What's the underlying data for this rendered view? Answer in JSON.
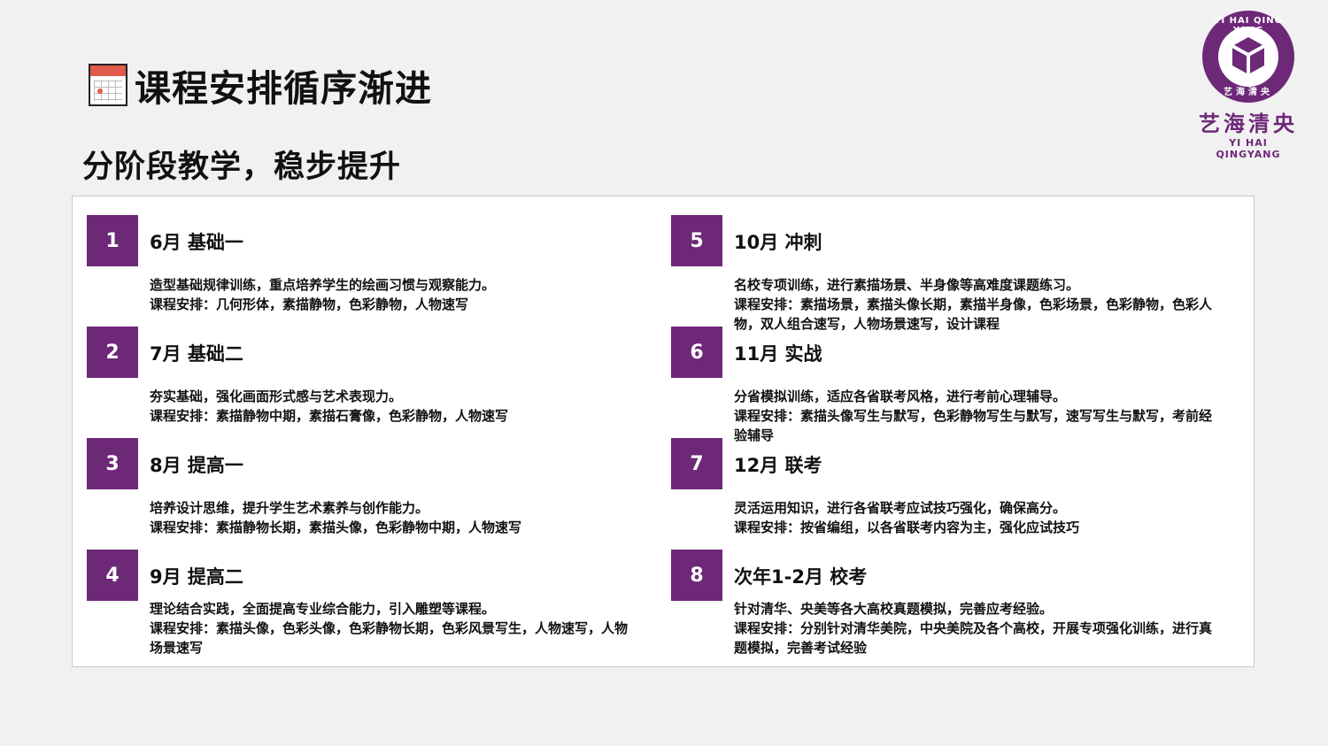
{
  "header": {
    "title": "课程安排循序渐进",
    "subtitle": "分阶段教学，稳步提升"
  },
  "logo": {
    "ring_top": "YI HAI QING YANG",
    "ring_bottom": "艺海清央",
    "name_cn": "艺海清央",
    "name_en": "YI HAI QINGYANG",
    "color": "#6d2878"
  },
  "accent_color": "#6d2878",
  "stages": [
    {
      "num": "1",
      "title": "6月 基础一",
      "desc": "造型基础规律训练，重点培养学生的绘画习惯与观察能力。",
      "plan": "课程安排：几何形体，素描静物，色彩静物，人物速写"
    },
    {
      "num": "2",
      "title": "7月 基础二",
      "desc": "夯实基础，强化画面形式感与艺术表现力。",
      "plan": "课程安排：素描静物中期，素描石膏像，色彩静物，人物速写"
    },
    {
      "num": "3",
      "title": "8月 提高一",
      "desc": "培养设计思维，提升学生艺术素养与创作能力。",
      "plan": "课程安排：素描静物长期，素描头像，色彩静物中期，人物速写"
    },
    {
      "num": "4",
      "title": "9月 提高二",
      "desc": "理论结合实践，全面提高专业综合能力，引入雕塑等课程。",
      "plan": "课程安排：素描头像，色彩头像，色彩静物长期，色彩风景写生，人物速写，人物场景速写"
    },
    {
      "num": "5",
      "title": "10月 冲刺",
      "desc": "名校专项训练，进行素描场景、半身像等高难度课题练习。",
      "plan": "课程安排：素描场景，素描头像长期，素描半身像，色彩场景，色彩静物，色彩人物，双人组合速写，人物场景速写，设计课程"
    },
    {
      "num": "6",
      "title": "11月 实战",
      "desc": "分省模拟训练，适应各省联考风格，进行考前心理辅导。",
      "plan": "课程安排：素描头像写生与默写，色彩静物写生与默写，速写写生与默写，考前经验辅导"
    },
    {
      "num": "7",
      "title": "12月 联考",
      "desc": "灵活运用知识，进行各省联考应试技巧强化，确保高分。",
      "plan": "课程安排：按省编组，以各省联考内容为主，强化应试技巧"
    },
    {
      "num": "8",
      "title": "次年1-2月 校考",
      "desc": "针对清华、央美等各大高校真题模拟，完善应考经验。",
      "plan": "课程安排：分别针对清华美院，中央美院及各个高校，开展专项强化训练，进行真题模拟，完善考试经验"
    }
  ]
}
